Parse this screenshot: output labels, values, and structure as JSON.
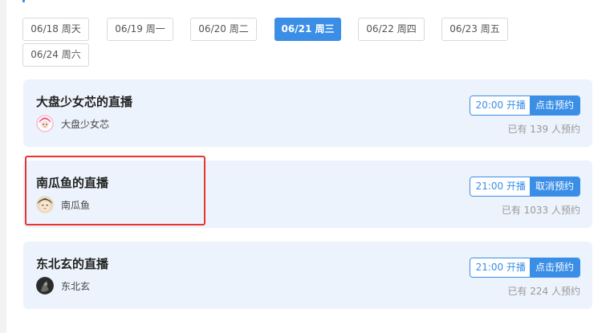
{
  "date_tabs": [
    {
      "label": "06/18 周天",
      "active": false
    },
    {
      "label": "06/19 周一",
      "active": false
    },
    {
      "label": "06/20 周二",
      "active": false
    },
    {
      "label": "06/21 周三",
      "active": true
    },
    {
      "label": "06/22 周四",
      "active": false
    },
    {
      "label": "06/23 周五",
      "active": false
    },
    {
      "label": "06/24 周六",
      "active": false
    }
  ],
  "streams": [
    {
      "title": "大盘少女芯的直播",
      "streamer": "大盘少女芯",
      "avatar_icon": "girl-avatar-icon",
      "time_label": "20:00 开播",
      "action_label": "点击预约",
      "count_label": "已有 139 人预约"
    },
    {
      "title": "南瓜鱼的直播",
      "streamer": "南瓜鱼",
      "avatar_icon": "cartoon-avatar-icon",
      "time_label": "21:00 开播",
      "action_label": "取消预约",
      "count_label": "已有 1033 人预约"
    },
    {
      "title": "东北玄的直播",
      "streamer": "东北玄",
      "avatar_icon": "dark-avatar-icon",
      "time_label": "21:00 开播",
      "action_label": "点击预约",
      "count_label": "已有 224 人预约"
    }
  ],
  "colors": {
    "accent": "#3a8ee6",
    "card_bg": "#edf3fc",
    "highlight": "#e8352d"
  }
}
